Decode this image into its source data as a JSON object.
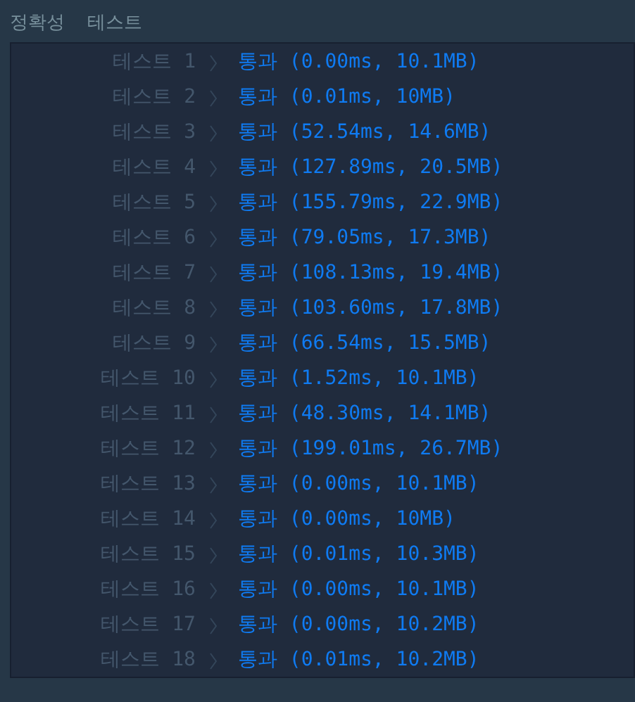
{
  "tabs": [
    {
      "label": "정확성"
    },
    {
      "label": "테스트"
    }
  ],
  "results": [
    {
      "label": "테스트 1",
      "result": "통과 (0.00ms, 10.1MB)"
    },
    {
      "label": "테스트 2",
      "result": "통과 (0.01ms, 10MB)"
    },
    {
      "label": "테스트 3",
      "result": "통과 (52.54ms, 14.6MB)"
    },
    {
      "label": "테스트 4",
      "result": "통과 (127.89ms, 20.5MB)"
    },
    {
      "label": "테스트 5",
      "result": "통과 (155.79ms, 22.9MB)"
    },
    {
      "label": "테스트 6",
      "result": "통과 (79.05ms, 17.3MB)"
    },
    {
      "label": "테스트 7",
      "result": "통과 (108.13ms, 19.4MB)"
    },
    {
      "label": "테스트 8",
      "result": "통과 (103.60ms, 17.8MB)"
    },
    {
      "label": "테스트 9",
      "result": "통과 (66.54ms, 15.5MB)"
    },
    {
      "label": "테스트 10",
      "result": "통과 (1.52ms, 10.1MB)"
    },
    {
      "label": "테스트 11",
      "result": "통과 (48.30ms, 14.1MB)"
    },
    {
      "label": "테스트 12",
      "result": "통과 (199.01ms, 26.7MB)"
    },
    {
      "label": "테스트 13",
      "result": "통과 (0.00ms, 10.1MB)"
    },
    {
      "label": "테스트 14",
      "result": "통과 (0.00ms, 10MB)"
    },
    {
      "label": "테스트 15",
      "result": "통과 (0.01ms, 10.3MB)"
    },
    {
      "label": "테스트 16",
      "result": "통과 (0.00ms, 10.1MB)"
    },
    {
      "label": "테스트 17",
      "result": "통과 (0.00ms, 10.2MB)"
    },
    {
      "label": "테스트 18",
      "result": "통과 (0.01ms, 10.2MB)"
    }
  ]
}
